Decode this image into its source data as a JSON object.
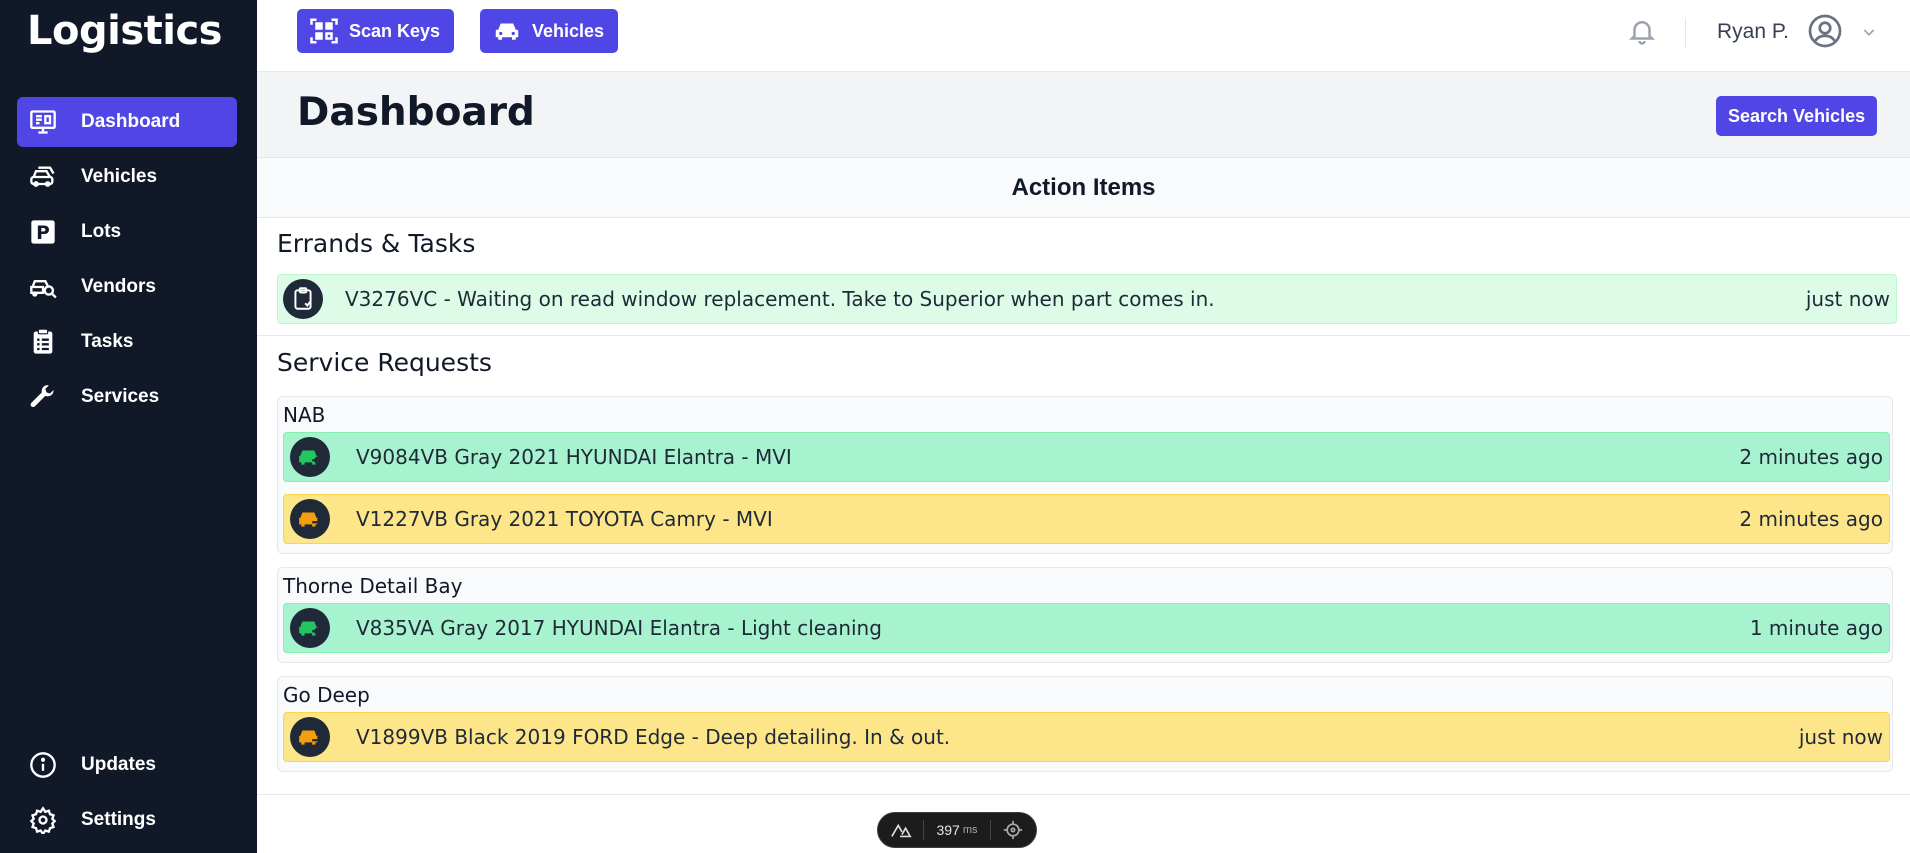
{
  "app": {
    "brand": "Logistics"
  },
  "sidebar": {
    "items": [
      {
        "label": "Dashboard",
        "icon": "dashboard-icon",
        "active": true
      },
      {
        "label": "Vehicles",
        "icon": "car-icon",
        "active": false
      },
      {
        "label": "Lots",
        "icon": "parking-icon",
        "active": false
      },
      {
        "label": "Vendors",
        "icon": "car-search-icon",
        "active": false
      },
      {
        "label": "Tasks",
        "icon": "clipboard-list-icon",
        "active": false
      },
      {
        "label": "Services",
        "icon": "wrench-icon",
        "active": false
      }
    ],
    "bottom_items": [
      {
        "label": "Updates",
        "icon": "info-icon"
      },
      {
        "label": "Settings",
        "icon": "gear-icon"
      }
    ]
  },
  "topbar": {
    "scan_keys_label": "Scan Keys",
    "vehicles_label": "Vehicles",
    "user_name": "Ryan P."
  },
  "header": {
    "title": "Dashboard",
    "search_button": "Search Vehicles"
  },
  "main": {
    "action_items_title": "Action Items",
    "errands_title": "Errands & Tasks",
    "errands": [
      {
        "text": "V3276VC - Waiting on read window replacement. Take to Superior when part comes in.",
        "time": "just now"
      }
    ],
    "service_title": "Service Requests",
    "groups": [
      {
        "name": "NAB",
        "rows": [
          {
            "text": "V9084VB Gray 2021 HYUNDAI Elantra - MVI",
            "time": "2 minutes ago",
            "status": "green"
          },
          {
            "text": "V1227VB Gray 2021 TOYOTA Camry - MVI",
            "time": "2 minutes ago",
            "status": "yellow"
          }
        ]
      },
      {
        "name": "Thorne Detail Bay",
        "rows": [
          {
            "text": "V835VA Gray 2017 HYUNDAI Elantra - Light cleaning",
            "time": "1 minute ago",
            "status": "green"
          }
        ]
      },
      {
        "name": "Go Deep",
        "rows": [
          {
            "text": "V1899VB Black 2019 FORD Edge - Deep detailing. In & out.",
            "time": "just now",
            "status": "yellow"
          }
        ]
      }
    ]
  },
  "devtools": {
    "timing": "397",
    "unit": "ms"
  },
  "colors": {
    "sidebar_bg": "#111827",
    "accent": "#4f46e5",
    "task_bg": "#dcfce7",
    "green_row": "#a7f3d0",
    "yellow_row": "#fde68a",
    "icon_green": "#22c55e",
    "icon_yellow": "#f59e0b"
  }
}
